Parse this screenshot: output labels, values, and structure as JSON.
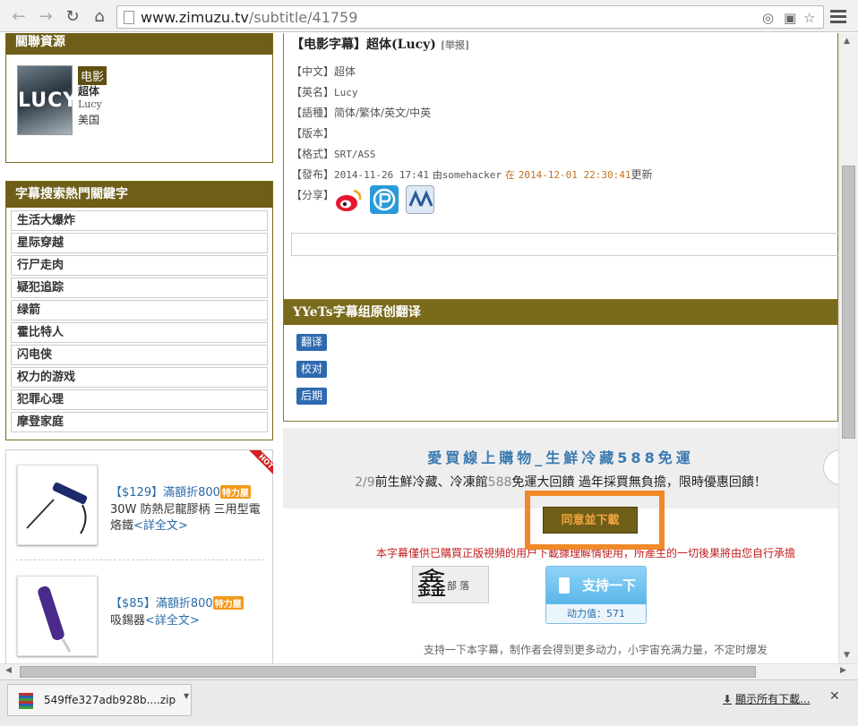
{
  "browser": {
    "url_host": "www.zimuzu.tv",
    "url_path": "/subtitle/41759"
  },
  "resource": {
    "heading": "關聯資源",
    "poster_text": "LUCY",
    "tag": "电影",
    "title_cn": "超体",
    "title_en": "Lucy",
    "country": "美国"
  },
  "keywords": {
    "heading": "字幕搜索熱門關鍵字",
    "items": [
      "生活大爆炸",
      "星际穿越",
      "行尸走肉",
      "疑犯追踪",
      "绿箭",
      "霍比特人",
      "闪电侠",
      "权力的游戏",
      "犯罪心理",
      "摩登家庭"
    ]
  },
  "ads": [
    {
      "price": "【$129】",
      "pct": "滿額折800",
      "badge": "特力屋",
      "desc": "30W 防熱尼龍膠柄 三用型電烙鐵",
      "more": "<詳全文>",
      "hot": "HOT"
    },
    {
      "price": "【$85】",
      "pct": "滿額折800",
      "badge": "特力屋",
      "desc": "吸錫器",
      "more": "<詳全文>"
    }
  ],
  "detail": {
    "title": "【电影字幕】超体(Lucy)",
    "report": "[举报]",
    "rows": [
      {
        "label": "【中文】",
        "value": "超体"
      },
      {
        "label": "【英名】",
        "value": "Lucy"
      },
      {
        "label": "【語種】",
        "value": "简体/繁体/英文/中英"
      },
      {
        "label": "【版本】",
        "value": ""
      },
      {
        "label": "【格式】",
        "value": "SRT/ASS"
      }
    ],
    "publish_label": "【發布】",
    "publish_time": "2014-11-26 17:41",
    "publish_by": "由somehacker",
    "publish_at": "在",
    "update_time": "2014-12-01 22:30:41",
    "update_suffix": "更新",
    "share_label": "【分享】"
  },
  "yyets": {
    "heading": "YYeTs字幕组原创翻译",
    "buttons": [
      "翻译",
      "校对",
      "后期"
    ]
  },
  "banner": {
    "title": "愛買線上購物_生鮮冷藏588免運",
    "prefix": "2/9",
    "text": "前生鮮冷藏、冷凍館",
    "num": "588",
    "text2": "免運大回饋 過年採買無負擔，限時優惠回饋！"
  },
  "download": {
    "button": "同意並下載",
    "disclaimer": "本字幕僅供已購買正版視頻的用户下載據理解情使用，所產生的一切後果將由您自行承擔"
  },
  "support": {
    "logo_char": "鑫",
    "logo_small": "部落",
    "button": "支持一下",
    "power": "动力值：571",
    "note": "支持一下本字幕，制作者会得到更多动力，小宇宙充满力量，不定时爆发"
  },
  "download_shelf": {
    "file": "549ffe327adb928b....zip",
    "show_all": "顯示所有下載..."
  },
  "colors": {
    "header_brown": "#6e5e18",
    "link_blue": "#2a6aa8",
    "highlight_orange": "#f08a28",
    "warn_red": "#c02020"
  }
}
